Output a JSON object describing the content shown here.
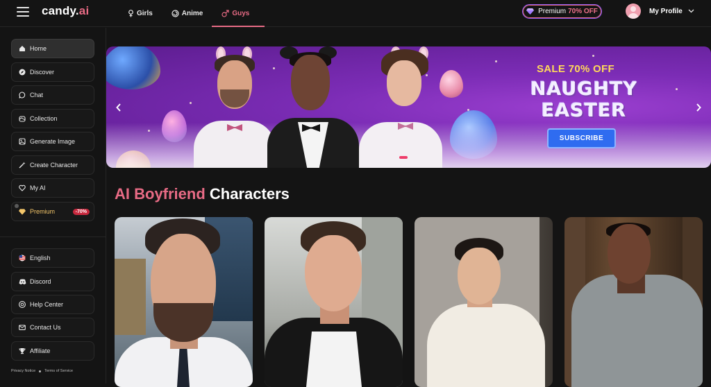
{
  "brand": {
    "name_main": "candy.",
    "name_accent": "ai"
  },
  "nav": {
    "tabs": [
      {
        "label": "Girls",
        "icon": "female-icon"
      },
      {
        "label": "Anime",
        "icon": "anime-swirl-icon"
      },
      {
        "label": "Guys",
        "icon": "male-icon",
        "active": true
      }
    ]
  },
  "header": {
    "premium": {
      "label": "Premium",
      "discount": "70% OFF",
      "icon": "diamond-icon"
    },
    "profile": {
      "label": "My Profile",
      "icon": "chevron-down-icon"
    }
  },
  "sidebar": {
    "items": [
      {
        "label": "Home",
        "icon": "home-icon",
        "active": true
      },
      {
        "label": "Discover",
        "icon": "compass-icon"
      },
      {
        "label": "Chat",
        "icon": "chat-icon"
      },
      {
        "label": "Collection",
        "icon": "collection-icon"
      },
      {
        "label": "Generate Image",
        "icon": "image-icon"
      },
      {
        "label": "Create Character",
        "icon": "magic-wand-icon"
      },
      {
        "label": "My AI",
        "icon": "heart-icon"
      },
      {
        "label": "Premium",
        "icon": "diamond-icon",
        "badge": "-70%"
      }
    ],
    "bottom_items": [
      {
        "label": "English",
        "icon": "us-flag-icon"
      },
      {
        "label": "Discord",
        "icon": "discord-icon"
      },
      {
        "label": "Help Center",
        "icon": "help-icon"
      },
      {
        "label": "Contact Us",
        "icon": "mail-icon"
      },
      {
        "label": "Affiliate",
        "icon": "trophy-icon"
      }
    ],
    "legal": {
      "privacy": "Privacy Notice",
      "terms": "Terms of Service"
    }
  },
  "banner": {
    "sale_text": "SALE 70% OFF",
    "headline_line1": "NAUGHTY",
    "headline_line2": "EASTER",
    "cta_label": "SUBSCRIBE"
  },
  "section": {
    "title_accent": "AI Boyfriend",
    "title_rest": "Characters"
  },
  "colors": {
    "accent": "#e86b85",
    "background": "#141414",
    "banner_purple": "#7b2cb5",
    "sale_yellow": "#ffd95a",
    "cta_blue": "#2f6cf0",
    "badge_red": "#c7283d"
  }
}
